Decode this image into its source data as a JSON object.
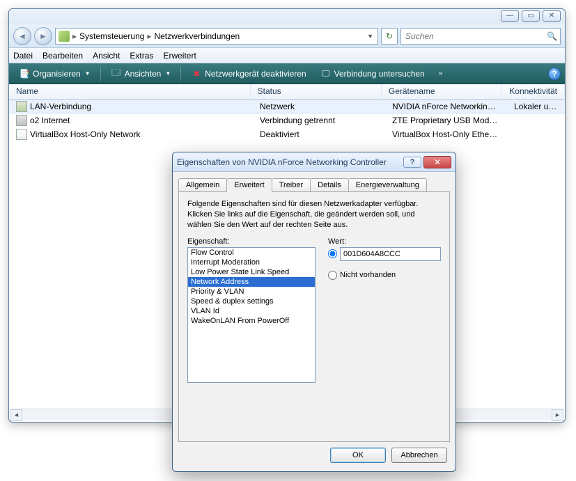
{
  "explorer": {
    "breadcrumb": {
      "seg1": "Systemsteuerung",
      "seg2": "Netzwerkverbindungen"
    },
    "search_placeholder": "Suchen",
    "menu": {
      "file": "Datei",
      "edit": "Bearbeiten",
      "view": "Ansicht",
      "extras": "Extras",
      "advanced": "Erweitert"
    },
    "cmdbar": {
      "organize": "Organisieren",
      "views": "Ansichten",
      "disable": "Netzwerkgerät deaktivieren",
      "inspect": "Verbindung untersuchen"
    },
    "columns": {
      "name": "Name",
      "status": "Status",
      "device": "Gerätename",
      "conn": "Konnektivität"
    },
    "rows": [
      {
        "name": "LAN-Verbindung",
        "status": "Netzwerk",
        "device": "NVIDIA nForce Networking Con...",
        "conn": "Lokaler und In",
        "icon": "lan",
        "selected": true
      },
      {
        "name": "o2 Internet",
        "status": "Verbindung getrennt",
        "device": "ZTE Proprietary USB Modem",
        "conn": "",
        "icon": "modem",
        "selected": false
      },
      {
        "name": "VirtualBox Host-Only Network",
        "status": "Deaktiviert",
        "device": "VirtualBox Host-Only Ethernet A...",
        "conn": "",
        "icon": "doc",
        "selected": false
      }
    ]
  },
  "dialog": {
    "title": "Eigenschaften von NVIDIA nForce Networking Controller",
    "tabs": {
      "general": "Allgemein",
      "advanced": "Erweitert",
      "driver": "Treiber",
      "details": "Details",
      "power": "Energieverwaltung"
    },
    "instructions": "Folgende Eigenschaften sind für diesen Netzwerkadapter verfügbar. Klicken Sie links auf die Eigenschaft, die geändert werden soll, und wählen Sie den Wert auf der rechten Seite aus.",
    "labels": {
      "property": "Eigenschaft:",
      "value": "Wert:",
      "not_present": "Nicht vorhanden"
    },
    "properties": [
      "Flow Control",
      "Interrupt Moderation",
      "Low Power State Link Speed",
      "Network Address",
      "Priority & VLAN",
      "Speed & duplex settings",
      "VLAN Id",
      "WakeOnLAN From PowerOff"
    ],
    "selected_index": 3,
    "value": "001D604A8CCC",
    "buttons": {
      "ok": "OK",
      "cancel": "Abbrechen"
    }
  }
}
